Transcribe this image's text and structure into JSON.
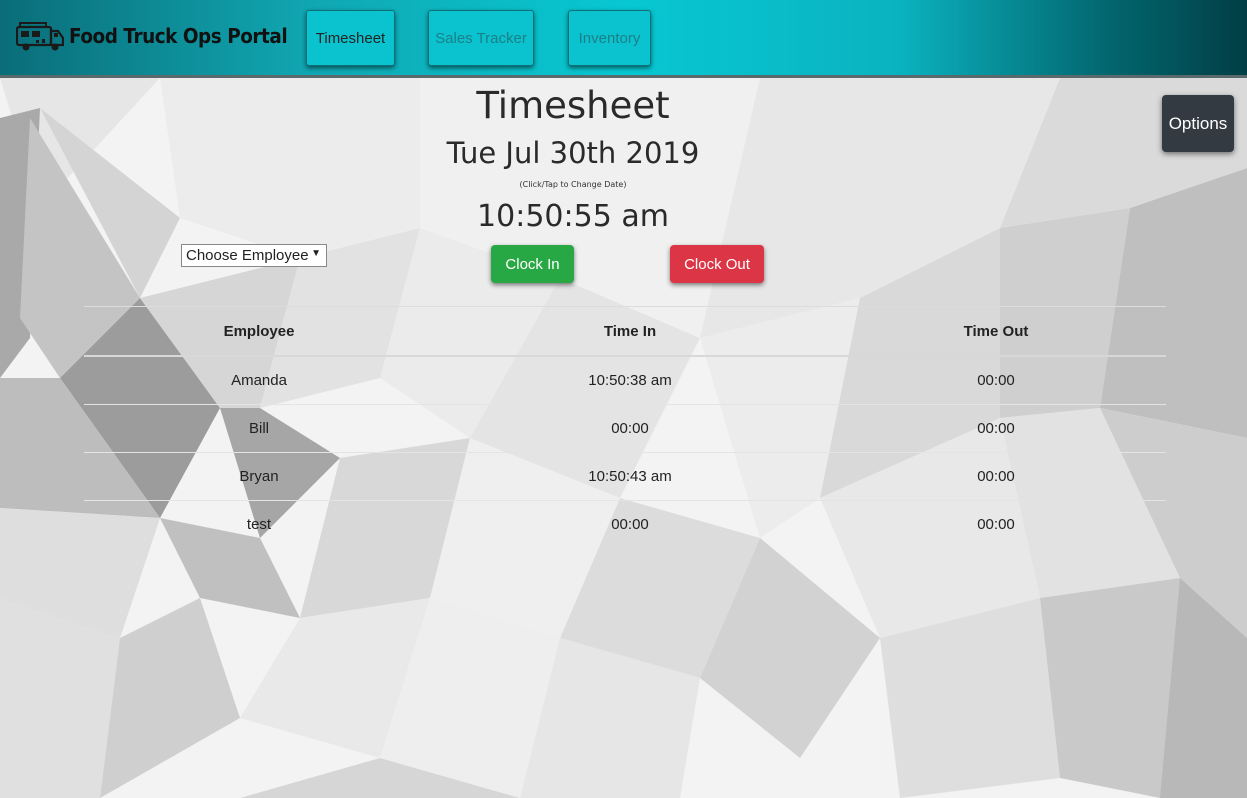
{
  "navbar": {
    "brand_title": "Food Truck Ops Portal",
    "brand_icon": "food-truck-icon",
    "tabs": [
      {
        "label": "Timesheet",
        "active": true
      },
      {
        "label": "Sales Tracker",
        "active": false
      },
      {
        "label": "Inventory",
        "active": false
      }
    ]
  },
  "options_label": "Options",
  "timesheet": {
    "title": "Timesheet",
    "date": "Tue Jul 30th 2019",
    "date_hint": "(Click/Tap to Change Date)",
    "clock": "10:50:55 am",
    "employee_select": {
      "selected": "Choose Employee"
    },
    "clock_in_label": "Clock In",
    "clock_out_label": "Clock Out",
    "table": {
      "headers": [
        "Employee",
        "Time In",
        "Time Out"
      ],
      "rows": [
        [
          "Amanda",
          "10:50:38 am",
          "00:00"
        ],
        [
          "Bill",
          "00:00",
          "00:00"
        ],
        [
          "Bryan",
          "10:50:43 am",
          "00:00"
        ],
        [
          "test",
          "00:00",
          "00:00"
        ]
      ]
    }
  },
  "colors": {
    "navbar_accent": "#07c8d2",
    "clock_in": "#28a745",
    "clock_out": "#dc3545",
    "options_bg": "#333a42"
  }
}
